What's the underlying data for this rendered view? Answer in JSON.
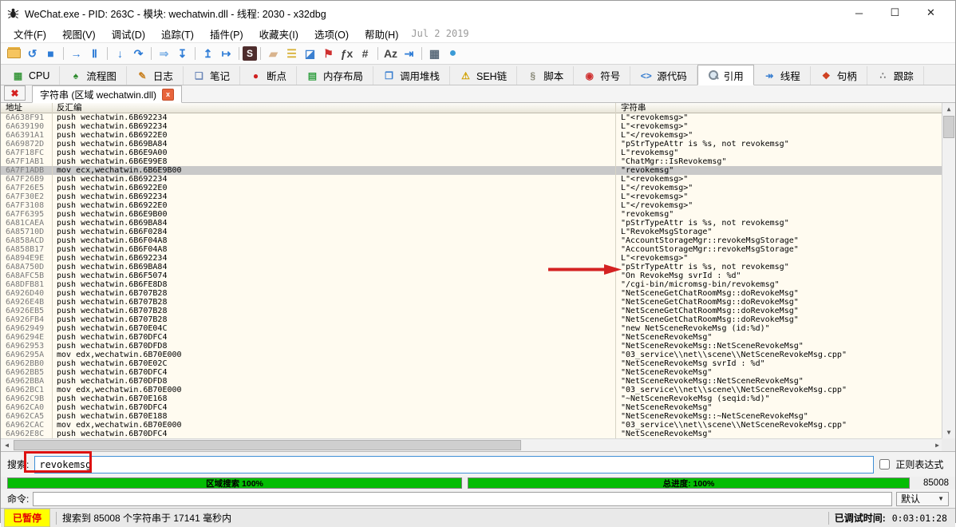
{
  "window": {
    "title": "WeChat.exe - PID: 263C - 模块: wechatwin.dll - 线程: 2030 - x32dbg",
    "controls": {
      "minimize": "─",
      "maximize": "☐",
      "close": "✕"
    }
  },
  "menu": {
    "items": [
      "文件(F)",
      "视图(V)",
      "调试(D)",
      "追踪(T)",
      "插件(P)",
      "收藏夹(I)",
      "选项(O)",
      "帮助(H)"
    ],
    "build_date": "Jul 2 2019"
  },
  "toolbar": {
    "groups": [
      [
        {
          "name": "open-file-icon",
          "glyph": "",
          "color": "#c7922b"
        },
        {
          "name": "restart-icon",
          "glyph": "↺",
          "color": "#2e7cd6"
        },
        {
          "name": "stop-icon",
          "glyph": "■",
          "color": "#2e7cd6"
        }
      ],
      [
        {
          "name": "run-icon",
          "glyph": "→",
          "color": "#2e7cd6"
        },
        {
          "name": "pause-icon",
          "glyph": "Ⅱ",
          "color": "#2e7cd6"
        }
      ],
      [
        {
          "name": "step-into-icon",
          "glyph": "↓",
          "color": "#2e7cd6"
        },
        {
          "name": "step-over-icon",
          "glyph": "↷",
          "color": "#2e7cd6"
        }
      ],
      [
        {
          "name": "run-until-icon",
          "glyph": "⇒",
          "color": "#79aee4"
        },
        {
          "name": "execute-till-return-icon",
          "glyph": "↧",
          "color": "#2e7cd6"
        }
      ],
      [
        {
          "name": "step-out-icon",
          "glyph": "↥",
          "color": "#2e7cd6"
        },
        {
          "name": "run-to-user-icon",
          "glyph": "↦",
          "color": "#2e7cd6"
        }
      ],
      [
        {
          "name": "source-s-icon",
          "glyph": "S",
          "color": "#ffffff"
        }
      ],
      [
        {
          "name": "patch-icon",
          "glyph": "▰",
          "color": "#d9b48e"
        },
        {
          "name": "comments-icon",
          "glyph": "☰",
          "color": "#d8b23a"
        },
        {
          "name": "labels-icon",
          "glyph": "◪",
          "color": "#3a7fd0"
        },
        {
          "name": "bookmarks-icon",
          "glyph": "⚑",
          "color": "#cf3030"
        },
        {
          "name": "functions-icon",
          "glyph": "ƒx",
          "color": "#444444"
        },
        {
          "name": "hash-icon",
          "glyph": "#",
          "color": "#444444"
        }
      ],
      [
        {
          "name": "strings-icon",
          "glyph": "Az",
          "color": "#444444"
        },
        {
          "name": "attach-icon",
          "glyph": "⇥",
          "color": "#2e7cd6"
        }
      ],
      [
        {
          "name": "calculator-icon",
          "glyph": "▦",
          "color": "#5a6a7a"
        },
        {
          "name": "internet-icon",
          "glyph": "●",
          "color": "#3a9ad6"
        }
      ]
    ]
  },
  "tabs": [
    {
      "label": "CPU",
      "icon": "cpu-icon",
      "glyph": "▦",
      "color": "#3d9940",
      "active": false
    },
    {
      "label": "流程图",
      "icon": "graph-icon",
      "glyph": "♠",
      "color": "#2e8b2e",
      "active": false
    },
    {
      "label": "日志",
      "icon": "log-icon",
      "glyph": "✎",
      "color": "#c87f1e",
      "active": false
    },
    {
      "label": "笔记",
      "icon": "notes-icon",
      "glyph": "❏",
      "color": "#6a86b8",
      "active": false
    },
    {
      "label": "断点",
      "icon": "breakpoint-icon",
      "glyph": "●",
      "color": "#cf2020",
      "active": false
    },
    {
      "label": "内存布局",
      "icon": "memory-map-icon",
      "glyph": "▤",
      "color": "#2f9e3f",
      "active": false
    },
    {
      "label": "调用堆栈",
      "icon": "call-stack-icon",
      "glyph": "❐",
      "color": "#3a7fd0",
      "active": false
    },
    {
      "label": "SEH链",
      "icon": "seh-chain-icon",
      "glyph": "⚠",
      "color": "#d0a000",
      "active": false
    },
    {
      "label": "脚本",
      "icon": "script-icon",
      "glyph": "§",
      "color": "#8a8a7a",
      "active": false
    },
    {
      "label": "符号",
      "icon": "symbols-icon",
      "glyph": "◉",
      "color": "#cf3030",
      "active": false
    },
    {
      "label": "源代码",
      "icon": "source-icon",
      "glyph": "<>",
      "color": "#3a7fd0",
      "active": false
    },
    {
      "label": "引用",
      "icon": "references-icon",
      "glyph": "",
      "color": "#7d8a96",
      "active": true
    },
    {
      "label": "线程",
      "icon": "threads-icon",
      "glyph": "↠",
      "color": "#3a7fd0",
      "active": false
    },
    {
      "label": "句柄",
      "icon": "handles-icon",
      "glyph": "❖",
      "color": "#cf4020",
      "active": false
    },
    {
      "label": "跟踪",
      "icon": "trace-icon",
      "glyph": "∴",
      "color": "#777777",
      "active": false
    }
  ],
  "subtab": {
    "close_all_glyph": "✖",
    "title": "字符串 (区域 wechatwin.dll)",
    "close_glyph": "x"
  },
  "table": {
    "columns": [
      "地址",
      "反汇编",
      "字符串"
    ],
    "highlight_term": "revokemsg",
    "selected_index": 6,
    "rows": [
      {
        "addr": "6A638F91",
        "disasm": "push wechatwin.6B692234",
        "str": "L\"<revokemsg>\""
      },
      {
        "addr": "6A639190",
        "disasm": "push wechatwin.6B692234",
        "str": "L\"<revokemsg>\""
      },
      {
        "addr": "6A6391A1",
        "disasm": "push wechatwin.6B6922E0",
        "str": "L\"</revokemsg>\""
      },
      {
        "addr": "6A69872D",
        "disasm": "push wechatwin.6B69BA84",
        "str": "\"pStrTypeAttr is %s, not revokemsg\""
      },
      {
        "addr": "6A7F18FC",
        "disasm": "push wechatwin.6B6E9A00",
        "str": "L\"revokemsg\""
      },
      {
        "addr": "6A7F1AB1",
        "disasm": "push wechatwin.6B6E99E8",
        "str": "\"ChatMgr::IsRevokemsg\""
      },
      {
        "addr": "6A7F1ADB",
        "disasm": "mov ecx,wechatwin.6B6E9B00",
        "str": "\"revokemsg\""
      },
      {
        "addr": "6A7F26B9",
        "disasm": "push wechatwin.6B692234",
        "str": "L\"<revokemsg>\""
      },
      {
        "addr": "6A7F26E5",
        "disasm": "push wechatwin.6B6922E0",
        "str": "L\"</revokemsg>\""
      },
      {
        "addr": "6A7F30E2",
        "disasm": "push wechatwin.6B692234",
        "str": "L\"<revokemsg>\""
      },
      {
        "addr": "6A7F3108",
        "disasm": "push wechatwin.6B6922E0",
        "str": "L\"</revokemsg>\""
      },
      {
        "addr": "6A7F6395",
        "disasm": "push wechatwin.6B6E9B00",
        "str": "\"revokemsg\""
      },
      {
        "addr": "6A81CAEA",
        "disasm": "push wechatwin.6B69BA84",
        "str": "\"pStrTypeAttr is %s, not revokemsg\""
      },
      {
        "addr": "6A85710D",
        "disasm": "push wechatwin.6B6F0284",
        "str": "L\"RevokeMsgStorage\""
      },
      {
        "addr": "6A858ACD",
        "disasm": "push wechatwin.6B6F04A8",
        "str": "\"AccountStorageMgr::revokeMsgStorage\""
      },
      {
        "addr": "6A858B17",
        "disasm": "push wechatwin.6B6F04A8",
        "str": "\"AccountStorageMgr::revokeMsgStorage\""
      },
      {
        "addr": "6A894E9E",
        "disasm": "push wechatwin.6B692234",
        "str": "L\"<revokemsg>\""
      },
      {
        "addr": "6A8A750D",
        "disasm": "push wechatwin.6B69BA84",
        "str": "\"pStrTypeAttr is %s, not revokemsg\""
      },
      {
        "addr": "6A8AFC5B",
        "disasm": "push wechatwin.6B6F5074",
        "str": "\"On RevokeMsg svrId : %d\""
      },
      {
        "addr": "6A8DFB81",
        "disasm": "push wechatwin.6B6FE8D8",
        "str": "\"/cgi-bin/micromsg-bin/revokemsg\""
      },
      {
        "addr": "6A926D40",
        "disasm": "push wechatwin.6B707B28",
        "str": "\"NetSceneGetChatRoomMsg::doRevokeMsg\""
      },
      {
        "addr": "6A926E4B",
        "disasm": "push wechatwin.6B707B28",
        "str": "\"NetSceneGetChatRoomMsg::doRevokeMsg\""
      },
      {
        "addr": "6A926EB5",
        "disasm": "push wechatwin.6B707B28",
        "str": "\"NetSceneGetChatRoomMsg::doRevokeMsg\""
      },
      {
        "addr": "6A926FB4",
        "disasm": "push wechatwin.6B707B28",
        "str": "\"NetSceneGetChatRoomMsg::doRevokeMsg\""
      },
      {
        "addr": "6A962949",
        "disasm": "push wechatwin.6B70E04C",
        "str": "\"new NetSceneRevokeMsg (id:%d)\""
      },
      {
        "addr": "6A96294E",
        "disasm": "push wechatwin.6B70DFC4",
        "str": "\"NetSceneRevokeMsg\""
      },
      {
        "addr": "6A962953",
        "disasm": "push wechatwin.6B70DFD8",
        "str": "\"NetSceneRevokeMsg::NetSceneRevokeMsg\""
      },
      {
        "addr": "6A96295A",
        "disasm": "mov edx,wechatwin.6B70E000",
        "str": "\"03_service\\\\net\\\\scene\\\\NetSceneRevokeMsg.cpp\""
      },
      {
        "addr": "6A962BB0",
        "disasm": "push wechatwin.6B70E02C",
        "str": "\"NetSceneRevokeMsg svrId : %d\""
      },
      {
        "addr": "6A962BB5",
        "disasm": "push wechatwin.6B70DFC4",
        "str": "\"NetSceneRevokeMsg\""
      },
      {
        "addr": "6A962BBA",
        "disasm": "push wechatwin.6B70DFD8",
        "str": "\"NetSceneRevokeMsg::NetSceneRevokeMsg\""
      },
      {
        "addr": "6A962BC1",
        "disasm": "mov edx,wechatwin.6B70E000",
        "str": "\"03_service\\\\net\\\\scene\\\\NetSceneRevokeMsg.cpp\""
      },
      {
        "addr": "6A962C9B",
        "disasm": "push wechatwin.6B70E168",
        "str": "\"~NetSceneRevokeMsg (seqid:%d)\""
      },
      {
        "addr": "6A962CA0",
        "disasm": "push wechatwin.6B70DFC4",
        "str": "\"NetSceneRevokeMsg\""
      },
      {
        "addr": "6A962CA5",
        "disasm": "push wechatwin.6B70E188",
        "str": "\"NetSceneRevokeMsg::~NetSceneRevokeMsg\""
      },
      {
        "addr": "6A962CAC",
        "disasm": "mov edx,wechatwin.6B70E000",
        "str": "\"03_service\\\\net\\\\scene\\\\NetSceneRevokeMsg.cpp\""
      },
      {
        "addr": "6A962E8C",
        "disasm": "push wechatwin.6B70DFC4",
        "str": "\"NetSceneRevokeMsg\""
      }
    ]
  },
  "search": {
    "label": "搜索:",
    "value": "revokemsg",
    "regex_label": "正则表达式",
    "regex_checked": false
  },
  "progress": {
    "region_label": "区域搜索 100%",
    "total_label": "总进度: 100%",
    "count": "85008",
    "bar_color": "#04bd04"
  },
  "command": {
    "label": "命令:",
    "value": "",
    "profile": "默认"
  },
  "statusbar": {
    "state": "已暂停",
    "message": "搜索到 85008 个字符串于 17141 毫秒内",
    "time_label": "已调试时间:",
    "time_value": "0:03:01:28"
  },
  "colors": {
    "selection": "#c9c9c9",
    "highlight_underline": "#e40000",
    "table_background": "#fffbf0",
    "status_paused_bg": "#ffff00",
    "status_paused_text": "#e40000"
  }
}
